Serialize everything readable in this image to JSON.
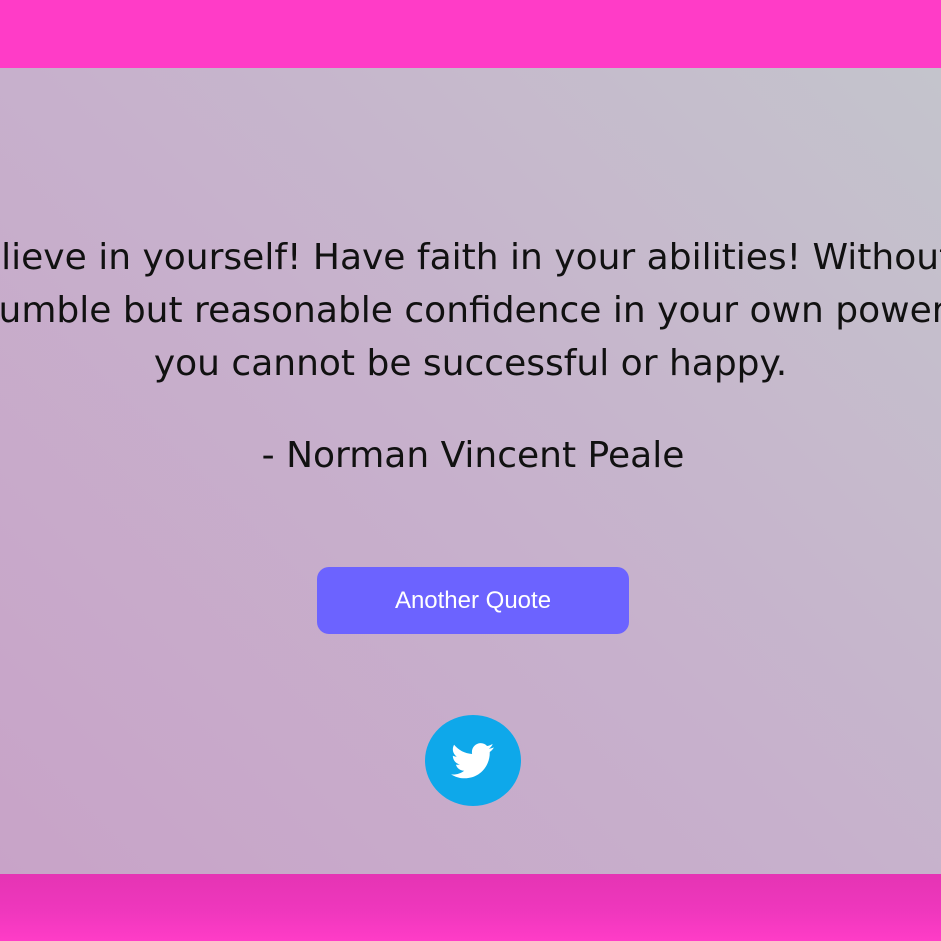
{
  "quote": {
    "text": "Believe in yourself! Have faith in your abilities! Without a humble but reasonable confidence in your own powers you cannot be successful or happy.",
    "author": "- Norman Vincent Peale"
  },
  "actions": {
    "another_quote_label": "Another Quote",
    "tweet_icon": "twitter-bird-icon"
  },
  "colors": {
    "header_bar": "#ff3cc7",
    "footer_bar": "#e534b4",
    "button": "#6c63ff",
    "twitter": "#0ea8ea",
    "text": "#111111"
  }
}
